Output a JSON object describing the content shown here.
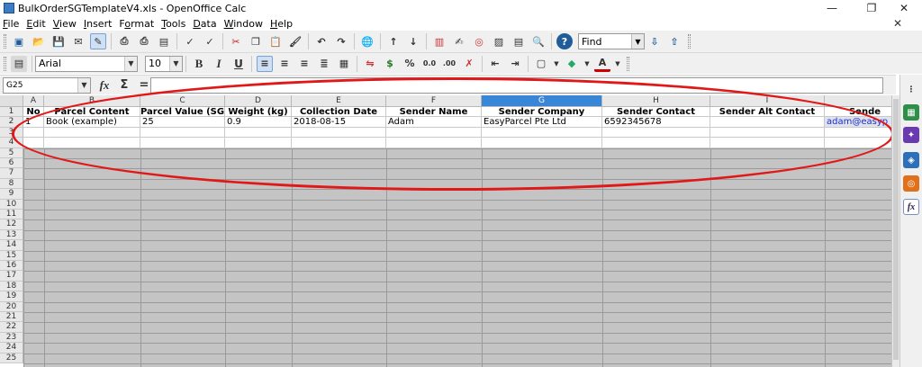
{
  "window": {
    "title": "BulkOrderSGTemplateV4.xls - OpenOffice Calc",
    "controls": {
      "minimize": "—",
      "restore": "❐",
      "close": "✕"
    }
  },
  "menubar": {
    "items": [
      {
        "pre": "",
        "accel": "F",
        "post": "ile"
      },
      {
        "pre": "",
        "accel": "E",
        "post": "dit"
      },
      {
        "pre": "",
        "accel": "V",
        "post": "iew"
      },
      {
        "pre": "",
        "accel": "I",
        "post": "nsert"
      },
      {
        "pre": "F",
        "accel": "o",
        "post": "rmat"
      },
      {
        "pre": "",
        "accel": "T",
        "post": "ools"
      },
      {
        "pre": "",
        "accel": "D",
        "post": "ata"
      },
      {
        "pre": "",
        "accel": "W",
        "post": "indow"
      },
      {
        "pre": "",
        "accel": "H",
        "post": "elp"
      }
    ],
    "close_doc": "✕"
  },
  "toolbar_standard": {
    "find_placeholder": "Find",
    "icons": [
      "new-icon",
      "open-icon",
      "save-icon",
      "email-icon",
      "edit-file-icon",
      "export-pdf-icon",
      "print-icon",
      "print-preview-icon",
      "spellcheck-icon",
      "autospell-icon",
      "cut-icon",
      "copy-icon",
      "paste-icon",
      "clone-format-icon",
      "undo-icon",
      "redo-icon",
      "hyperlink-icon",
      "sort-ascending-icon",
      "sort-descending-icon",
      "chart-icon",
      "show-draw-icon",
      "navigator-icon",
      "gallery-icon",
      "datasources-icon",
      "zoom-icon",
      "help-icon"
    ]
  },
  "toolbar_formatting": {
    "font_name": "Arial",
    "font_size": "10",
    "bold": "B",
    "italic": "I",
    "underline": "U",
    "currency": "$",
    "percent": "%",
    "add_decimal": "0.0"
  },
  "formula_bar": {
    "name_box": "G25",
    "function_wizard": "fx",
    "sum": "Σ",
    "equals": "="
  },
  "sheet": {
    "columns": [
      "A",
      "B",
      "C",
      "D",
      "E",
      "F",
      "G",
      "H",
      "I",
      ""
    ],
    "selected_column": "G",
    "rows": [
      "1",
      "2",
      "3",
      "4",
      "5",
      "6",
      "7",
      "8",
      "9",
      "10",
      "11",
      "12",
      "13",
      "14",
      "15",
      "16",
      "17",
      "18",
      "19",
      "20",
      "21",
      "22",
      "23",
      "24",
      "25"
    ],
    "header_row": [
      "No",
      "Parcel Content",
      "Parcel Value (SGD",
      "Weight (kg)",
      "Collection Date",
      "Sender Name",
      "Sender Company",
      "Sender Contact",
      "Sender Alt Contact",
      "Sende"
    ],
    "data_row": [
      "1",
      "Book (example)",
      "25",
      "0.9",
      "2018-08-15",
      "Adam",
      "EasyParcel Pte Ltd",
      "6592345678",
      "",
      "adam@easyp"
    ]
  },
  "colors": {
    "annotation_oval": "#e01818",
    "selected_column": "#3a86d6",
    "email_link": "#1e2ec8"
  }
}
